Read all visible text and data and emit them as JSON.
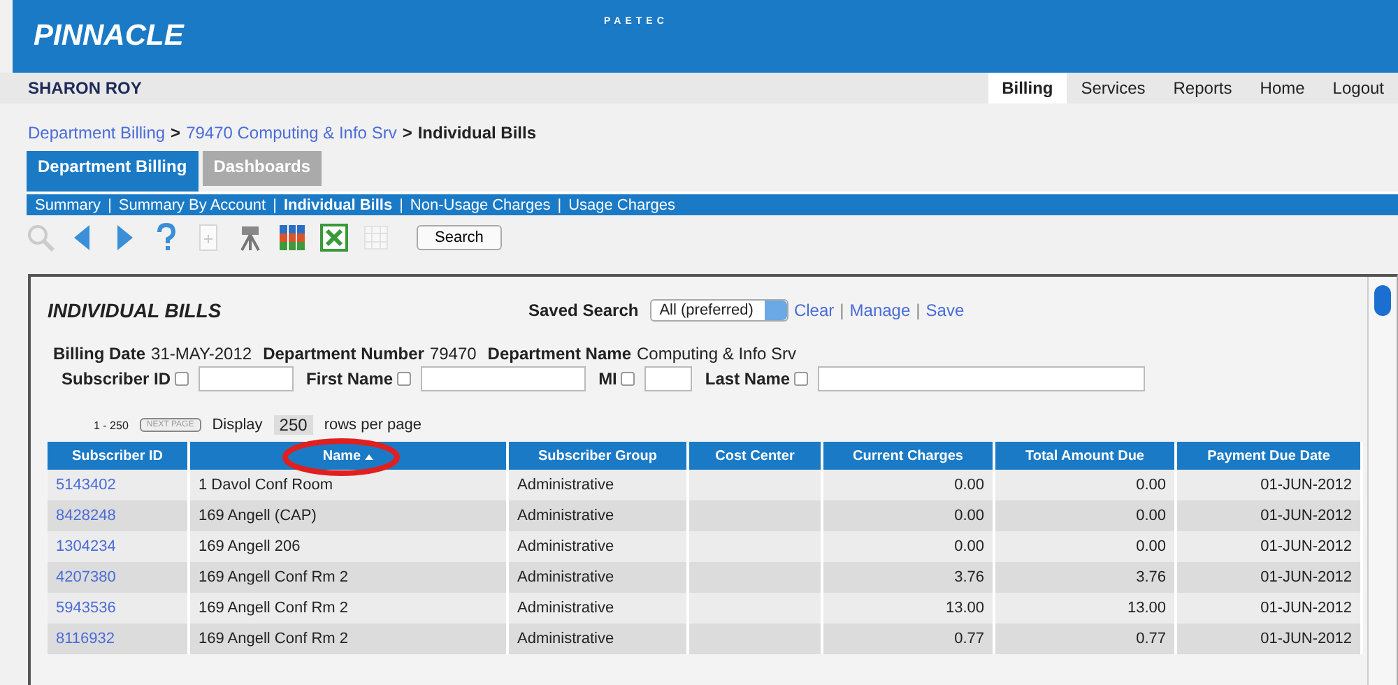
{
  "header": {
    "logo": "PINNACLE",
    "brand": "PAETEC"
  },
  "user_bar": {
    "user": "SHARON ROY",
    "nav": [
      {
        "label": "Billing",
        "selected": true
      },
      {
        "label": "Services",
        "selected": false
      },
      {
        "label": "Reports",
        "selected": false
      },
      {
        "label": "Home",
        "selected": false
      },
      {
        "label": "Logout",
        "selected": false
      }
    ]
  },
  "breadcrumb": {
    "links": [
      "Department Billing",
      "79470 Computing & Info Srv"
    ],
    "separator": ">",
    "current": "Individual Bills"
  },
  "tabs": [
    {
      "label": "Department Billing",
      "selected": true
    },
    {
      "label": "Dashboards",
      "selected": false
    }
  ],
  "subnav_separator": "|",
  "subnav": [
    {
      "label": "Summary",
      "selected": false
    },
    {
      "label": "Summary By Account",
      "selected": false
    },
    {
      "label": "Individual Bills",
      "selected": true
    },
    {
      "label": "Non-Usage Charges",
      "selected": false
    },
    {
      "label": "Usage Charges",
      "selected": false
    }
  ],
  "toolbar": {
    "icons": [
      {
        "kind": "zoom",
        "disabled": true
      },
      {
        "kind": "prev",
        "disabled": false
      },
      {
        "kind": "next",
        "disabled": false
      },
      {
        "kind": "help",
        "disabled": false
      },
      {
        "kind": "doc",
        "disabled": true
      },
      {
        "kind": "tripod",
        "disabled": false
      },
      {
        "kind": "grid",
        "disabled": false
      },
      {
        "kind": "excel",
        "disabled": false
      },
      {
        "kind": "table",
        "disabled": true
      }
    ],
    "search_button": "Search"
  },
  "panel": {
    "title": "INDIVIDUAL BILLS",
    "saved_search": {
      "label": "Saved Search",
      "value": "All (preferred)",
      "links": [
        "Clear",
        "Manage",
        "Save"
      ],
      "separator": "|"
    },
    "info": [
      {
        "label": "Billing Date",
        "value": "31-MAY-2012"
      },
      {
        "label": "Department Number",
        "value": "79470"
      },
      {
        "label": "Department Name",
        "value": "Computing & Info Srv"
      }
    ],
    "filters": [
      {
        "label": "Subscriber ID"
      },
      {
        "label": "First Name"
      },
      {
        "label": "MI"
      },
      {
        "label": "Last Name"
      }
    ],
    "pagination": {
      "range": "1 - 250",
      "next_button": "NEXT PAGE",
      "display_label": "Display",
      "rows_value": "250",
      "rows_label": "rows per page"
    }
  },
  "table": {
    "columns": [
      {
        "label": "Subscriber ID",
        "sorted": false
      },
      {
        "label": "Name",
        "sorted": true
      },
      {
        "label": "Subscriber Group",
        "sorted": false
      },
      {
        "label": "Cost Center",
        "sorted": false
      },
      {
        "label": "Current Charges",
        "sorted": false
      },
      {
        "label": "Total Amount Due",
        "sorted": false
      },
      {
        "label": "Payment Due Date",
        "sorted": false
      }
    ],
    "rows": [
      [
        "5143402",
        "1 Davol Conf Room",
        "Administrative",
        "",
        "0.00",
        "0.00",
        "01-JUN-2012"
      ],
      [
        "8428248",
        "169 Angell (CAP)",
        "Administrative",
        "",
        "0.00",
        "0.00",
        "01-JUN-2012"
      ],
      [
        "1304234",
        "169 Angell 206",
        "Administrative",
        "",
        "0.00",
        "0.00",
        "01-JUN-2012"
      ],
      [
        "4207380",
        "169 Angell Conf Rm 2",
        "Administrative",
        "",
        "3.76",
        "3.76",
        "01-JUN-2012"
      ],
      [
        "5943536",
        "169 Angell Conf Rm 2",
        "Administrative",
        "",
        "13.00",
        "13.00",
        "01-JUN-2012"
      ],
      [
        "8116932",
        "169 Angell Conf Rm 2",
        "Administrative",
        "",
        "0.77",
        "0.77",
        "01-JUN-2012"
      ]
    ]
  }
}
